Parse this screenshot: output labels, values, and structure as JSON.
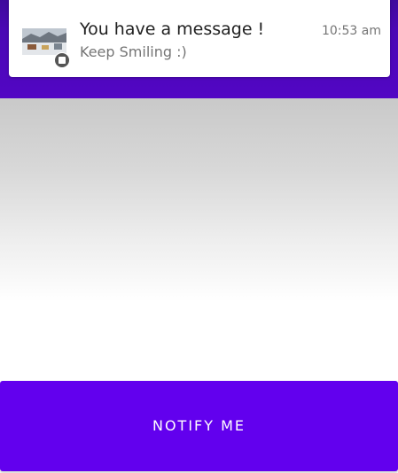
{
  "notification": {
    "title": "You have a message !",
    "text": "Keep Smiling :)",
    "time": "10:53 am",
    "large_icon": "landscape-photo-thumbnail",
    "small_icon": "app-notification-icon"
  },
  "main": {
    "notify_button_label": "NOTIFY ME"
  },
  "colors": {
    "app_bar": "#5206c4",
    "button": "#6200ee",
    "button_text": "#ffffff"
  }
}
